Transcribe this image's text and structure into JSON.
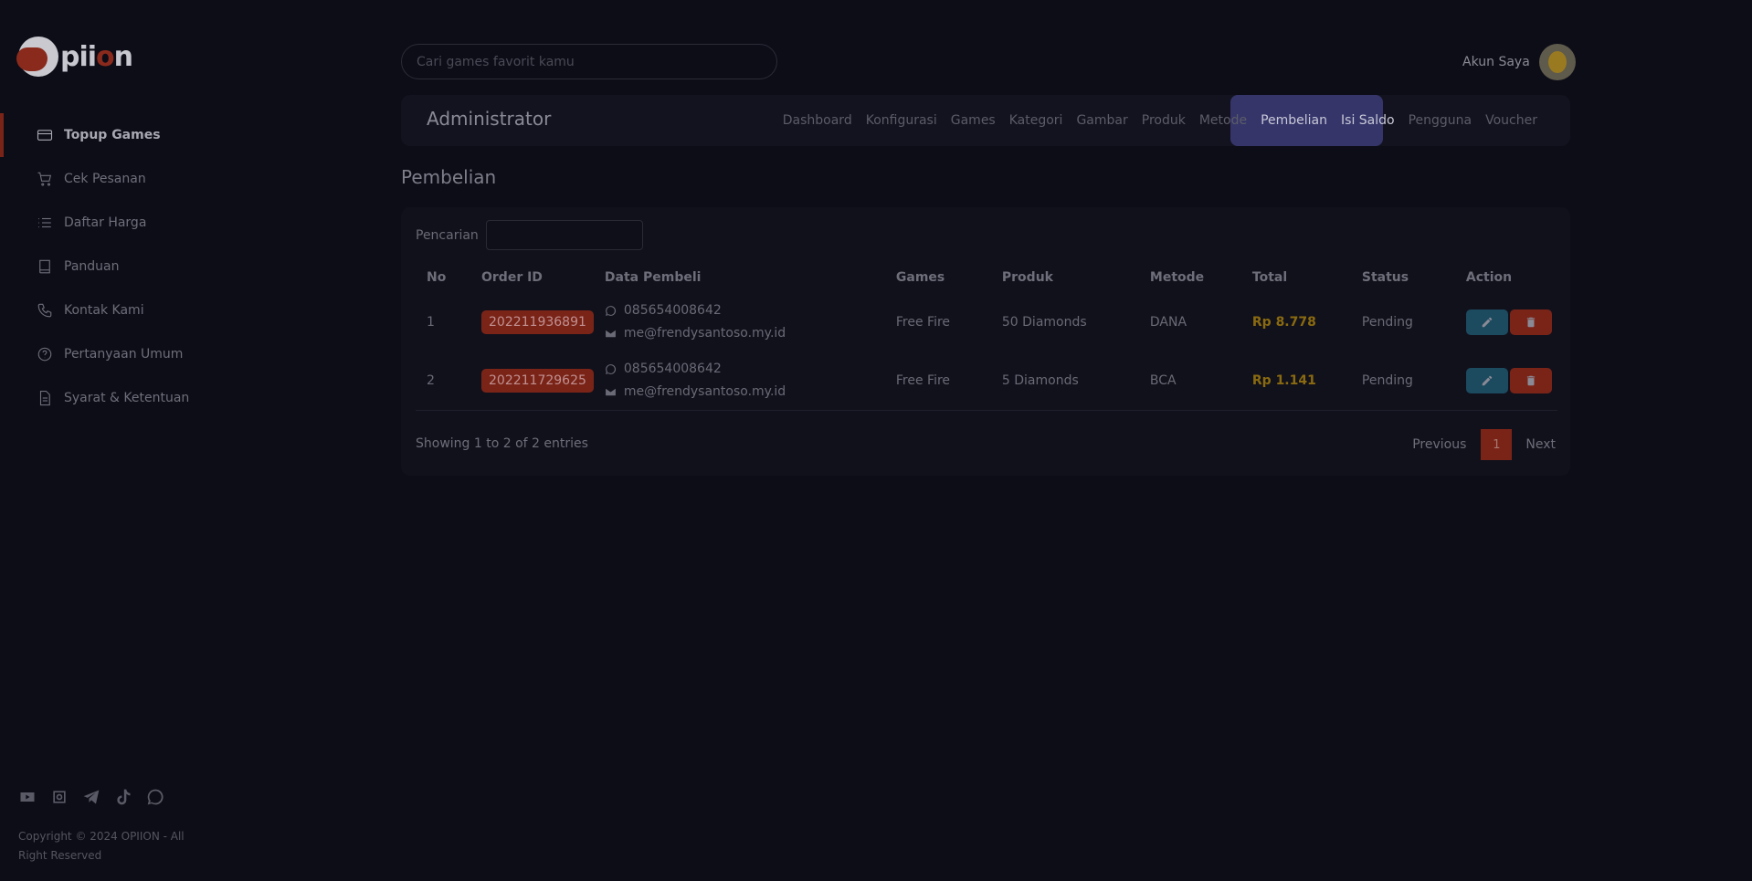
{
  "brand": {
    "logo_text_a": "pii",
    "logo_text_o": "o",
    "logo_text_b": "n"
  },
  "search": {
    "placeholder": "Cari games favorit kamu"
  },
  "account": {
    "label": "Akun Saya"
  },
  "sidebar": {
    "items": [
      {
        "label": "Topup Games",
        "icon": "credit-card-icon",
        "active": true
      },
      {
        "label": "Cek Pesanan",
        "icon": "cart-icon"
      },
      {
        "label": "Daftar Harga",
        "icon": "list-icon"
      },
      {
        "label": "Panduan",
        "icon": "book-icon"
      },
      {
        "label": "Kontak Kami",
        "icon": "phone-icon"
      },
      {
        "label": "Pertanyaan Umum",
        "icon": "question-icon"
      },
      {
        "label": "Syarat & Ketentuan",
        "icon": "document-icon"
      }
    ],
    "socials": [
      "youtube-icon",
      "instagram-icon",
      "telegram-icon",
      "tiktok-icon",
      "whatsapp-icon"
    ],
    "copyright": "Copyright © 2024 OPIION - All Right Reserved"
  },
  "admin": {
    "title": "Administrator",
    "nav": [
      "Dashboard",
      "Konfigurasi",
      "Games",
      "Kategori",
      "Gambar",
      "Produk",
      "Metode",
      "Pembelian",
      "Isi Saldo",
      "Pengguna",
      "Voucher"
    ],
    "active": "Pembelian"
  },
  "page": {
    "title": "Pembelian"
  },
  "filter": {
    "label": "Pencarian"
  },
  "table": {
    "headers": [
      "No",
      "Order ID",
      "Data Pembeli",
      "Games",
      "Produk",
      "Metode",
      "Total",
      "Status",
      "Action"
    ],
    "rows": [
      {
        "no": "1",
        "order_id": "202211936891",
        "phone": "085654008642",
        "email": "me@frendysantoso.my.id",
        "game": "Free Fire",
        "product": "50 Diamonds",
        "method": "DANA",
        "total": "Rp 8.778",
        "status": "Pending"
      },
      {
        "no": "2",
        "order_id": "202211729625",
        "phone": "085654008642",
        "email": "me@frendysantoso.my.id",
        "game": "Free Fire",
        "product": "5 Diamonds",
        "method": "BCA",
        "total": "Rp 1.141",
        "status": "Pending"
      }
    ]
  },
  "footer": {
    "showing": "Showing 1 to 2 of 2 entries",
    "previous": "Previous",
    "page": "1",
    "next": "Next"
  },
  "colors": {
    "accent": "#7a2418",
    "highlight": "#35356a",
    "background": "#0d0d18"
  }
}
